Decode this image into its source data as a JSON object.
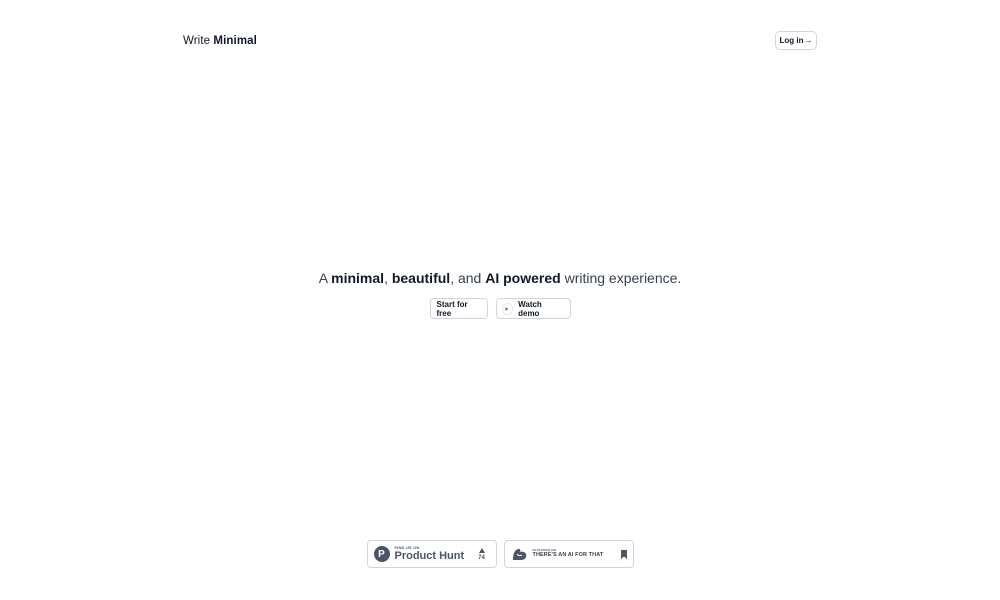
{
  "header": {
    "brand_prefix": "Write",
    "brand_emphasis": "Minimal",
    "login_label": "Log in",
    "login_arrow": "→"
  },
  "hero": {
    "part1": "A ",
    "bold1": "minimal",
    "part2": ", ",
    "bold2": "beautiful",
    "part3": ", and ",
    "bold3": "AI powered",
    "part4": " writing experience."
  },
  "cta": {
    "start_label": "Start for free",
    "demo_label": "Watch demo",
    "play_icon": "play-icon"
  },
  "badges": {
    "product_hunt": {
      "small_text": "FIND US ON",
      "big_text": "Product Hunt",
      "logo_letter": "P",
      "votes": "74"
    },
    "ai_for_that": {
      "small_text": "FEATURED ON",
      "big_text": "THERE'S AN AI FOR THAT"
    }
  },
  "colors": {
    "text": "#111827",
    "border": "#d1d5db",
    "badge_gray": "#4b5563"
  }
}
